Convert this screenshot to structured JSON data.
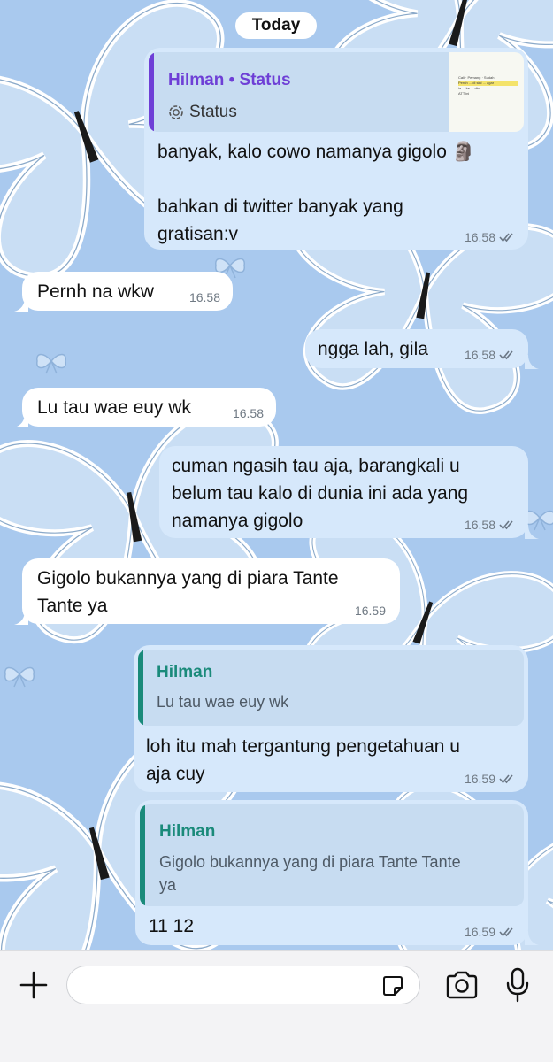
{
  "chat": {
    "date_separator": "Today",
    "messages": [
      {
        "direction": "out",
        "status_reply": {
          "author": "Hilman • Status",
          "label": "Status",
          "thumb_lines": [
            "Cali · Pemang · Sudah",
            "Pernh ... di sini ... agar",
            "ia ... ke ... ribu",
            "ATT ini"
          ]
        },
        "text_lines": [
          "banyak, kalo cowo namanya gigolo 🗿",
          "",
          "bahkan di twitter banyak yang",
          "gratisan:v"
        ],
        "time": "16.58",
        "ticks": "double-check-icon"
      },
      {
        "direction": "in",
        "text_lines": [
          "Pernh na wkw"
        ],
        "time": "16.58"
      },
      {
        "direction": "out",
        "text_lines": [
          "ngga lah, gila"
        ],
        "time": "16.58",
        "ticks": "double-check-icon"
      },
      {
        "direction": "in",
        "text_lines": [
          "Lu tau wae euy wk"
        ],
        "time": "16.58"
      },
      {
        "direction": "out",
        "text_lines": [
          "cuman ngasih tau aja, barangkali u",
          "belum tau kalo di dunia ini ada yang",
          "namanya gigolo"
        ],
        "time": "16.58",
        "ticks": "double-check-icon"
      },
      {
        "direction": "in",
        "text_lines": [
          "Gigolo bukannya yang di piara Tante",
          "Tante ya"
        ],
        "time": "16.59"
      },
      {
        "direction": "out",
        "reply": {
          "author": "Hilman",
          "text_lines": [
            "Lu tau wae euy wk"
          ]
        },
        "text_lines": [
          "loh itu mah tergantung pengetahuan u",
          "aja cuy"
        ],
        "time": "16.59",
        "ticks": "double-check-icon"
      },
      {
        "direction": "out",
        "reply": {
          "author": "Hilman",
          "text_lines": [
            "Gigolo bukannya yang di piara Tante Tante",
            "ya"
          ]
        },
        "text_lines": [
          "11 12"
        ],
        "time": "16.59",
        "ticks": "double-check-icon"
      }
    ]
  },
  "composer": {
    "placeholder": "",
    "value": "",
    "icons": {
      "attach": "plus-icon",
      "sticker": "sticker-icon",
      "camera": "camera-icon",
      "mic": "microphone-icon"
    }
  },
  "colors": {
    "wallpaper": "#a9c9ee",
    "incoming_bubble": "#ffffff",
    "outgoing_bubble": "#d6e8fb",
    "status_accent": "#6e3fd6",
    "reply_accent": "#1a8a7a",
    "read_ticks": "#6b7785"
  }
}
